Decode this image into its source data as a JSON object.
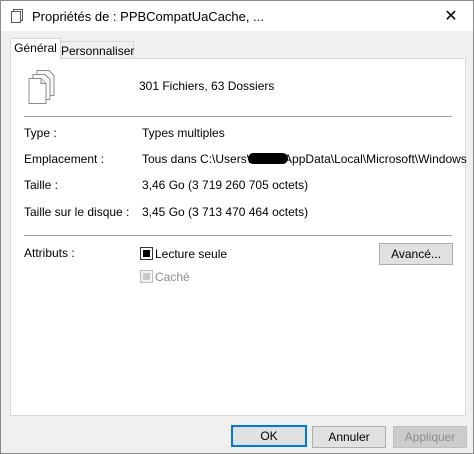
{
  "window": {
    "title": "Propriétés de : PPBCompatUaCache, ...",
    "close_glyph": "✕"
  },
  "tabs": [
    {
      "label": "Général",
      "active": true
    },
    {
      "label": "Personnaliser",
      "active": false
    }
  ],
  "general": {
    "summary": "301 Fichiers, 63 Dossiers",
    "type_label": "Type :",
    "type_value": "Types multiples",
    "location_label": "Emplacement :",
    "location_prefix": "Tous dans C:\\Users\\",
    "location_suffix": "AppData\\Local\\Microsoft\\Windows",
    "size_label": "Taille :",
    "size_value": "3,46 Go (3 719 260 705 octets)",
    "disk_size_label": "Taille sur le disque :",
    "disk_size_value": "3,45 Go (3 713 470 464 octets)",
    "attributes_label": "Attributs :",
    "readonly_label": "Lecture seule",
    "readonly_state": "indeterminate",
    "hidden_label": "Caché",
    "hidden_state": "indeterminate-disabled",
    "advanced_button": "Avancé..."
  },
  "footer": {
    "ok": "OK",
    "cancel": "Annuler",
    "apply": "Appliquer",
    "apply_enabled": false
  },
  "icons": {
    "title": "folder-properties-icon",
    "files": "multiple-files-icon",
    "close": "close-icon"
  },
  "colors": {
    "focus_border": "#0078d7",
    "separator": "#a0a0a0",
    "dialog_bg": "#f0f0f0"
  }
}
